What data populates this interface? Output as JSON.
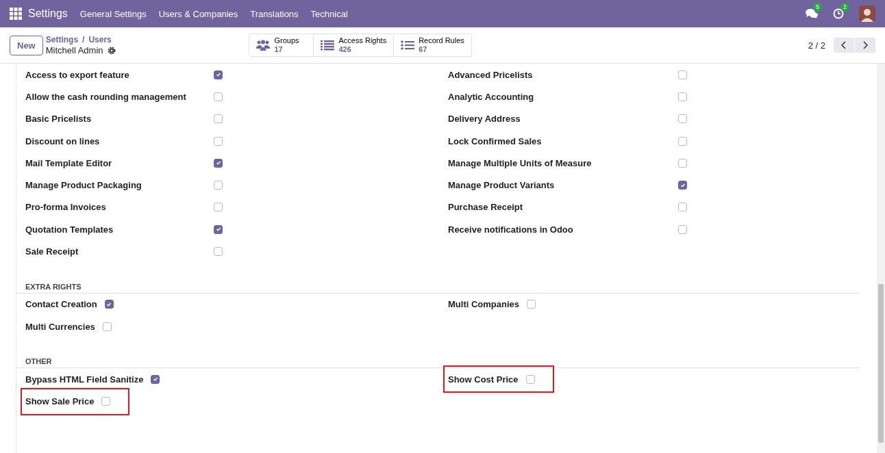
{
  "navbar": {
    "app_name": "Settings",
    "menu": [
      "General Settings",
      "Users & Companies",
      "Translations",
      "Technical"
    ],
    "messages_badge": "5",
    "activities_badge": "2"
  },
  "control_panel": {
    "new_button": "New",
    "breadcrumb": [
      "Settings",
      "Users"
    ],
    "breadcrumb_separator": "/",
    "record_title": "Mitchell Admin",
    "stat_buttons": [
      {
        "label": "Groups",
        "value": "17",
        "kind": "groups"
      },
      {
        "label": "Access Rights",
        "value": "426",
        "kind": "list"
      },
      {
        "label": "Record Rules",
        "value": "67",
        "kind": "bullets"
      }
    ],
    "pager": "2 / 2"
  },
  "sections": [
    {
      "kind": "table",
      "columns": [
        [
          {
            "label": "Access to export feature",
            "checked": true
          },
          {
            "label": "Allow the cash rounding management",
            "checked": false
          },
          {
            "label": "Basic Pricelists",
            "checked": false
          },
          {
            "label": "Discount on lines",
            "checked": false
          },
          {
            "label": "Mail Template Editor",
            "checked": true
          },
          {
            "label": "Manage Product Packaging",
            "checked": false
          },
          {
            "label": "Pro-forma Invoices",
            "checked": false
          },
          {
            "label": "Quotation Templates",
            "checked": true
          },
          {
            "label": "Sale Receipt",
            "checked": false
          }
        ],
        [
          {
            "label": "Advanced Pricelists",
            "checked": false
          },
          {
            "label": "Analytic Accounting",
            "checked": false
          },
          {
            "label": "Delivery Address",
            "checked": false
          },
          {
            "label": "Lock Confirmed Sales",
            "checked": false
          },
          {
            "label": "Manage Multiple Units of Measure",
            "checked": false
          },
          {
            "label": "Manage Product Variants",
            "checked": true
          },
          {
            "label": "Purchase Receipt",
            "checked": false
          },
          {
            "label": "Receive notifications in Odoo",
            "checked": false
          }
        ]
      ]
    },
    {
      "kind": "inline",
      "title": "EXTRA RIGHTS",
      "columns": [
        [
          {
            "label": "Contact Creation",
            "checked": true,
            "highlighted": false
          },
          {
            "label": "Multi Currencies",
            "checked": false,
            "highlighted": false
          }
        ],
        [
          {
            "label": "Multi Companies",
            "checked": false,
            "highlighted": false
          }
        ]
      ]
    },
    {
      "kind": "inline",
      "title": "OTHER",
      "columns": [
        [
          {
            "label": "Bypass HTML Field Sanitize",
            "checked": true,
            "highlighted": false
          },
          {
            "label": "Show Sale Price",
            "checked": false,
            "highlighted": true
          }
        ],
        [
          {
            "label": "Show Cost Price",
            "checked": false,
            "highlighted": true
          }
        ]
      ]
    }
  ]
}
